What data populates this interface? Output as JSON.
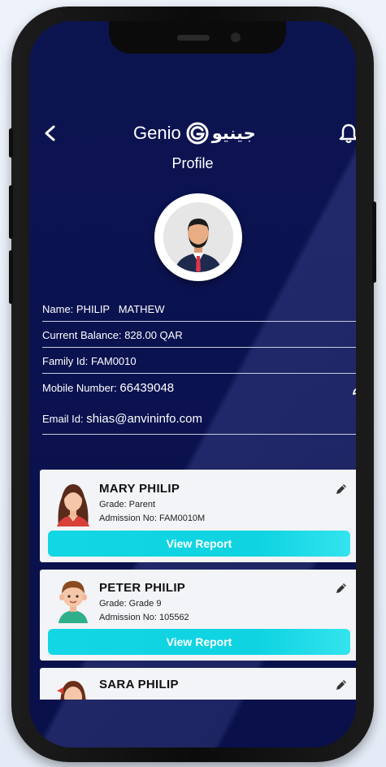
{
  "header": {
    "logo_text": "Genio",
    "logo_arabic": "جينيو",
    "title": "Profile"
  },
  "profile": {
    "name_label": "Name:",
    "name_value": "PHILIP   MATHEW",
    "balance_label": "Current Balance:",
    "balance_value": "828.00 QAR",
    "family_label": "Family Id:",
    "family_value": "FAM0010",
    "mobile_label": "Mobile Number:",
    "mobile_value": "66439048",
    "email_label": "Email Id:",
    "email_value": "shias@anvininfo.com"
  },
  "students": [
    {
      "name": "MARY  PHILIP",
      "grade": "Grade: Parent",
      "admission": "Admission No: FAM0010M",
      "button": "View Report",
      "avatar": "woman-avatar"
    },
    {
      "name": "PETER  PHILIP",
      "grade": "Grade: Grade 9",
      "admission": "Admission No: 105562",
      "button": "View Report",
      "avatar": "boy-avatar"
    },
    {
      "name": "SARA  PHILIP",
      "avatar": "girl-avatar"
    }
  ],
  "colors": {
    "screen_bg": "#0c1450",
    "accent_button": "#12d6e4",
    "card_bg": "#f3f4f7"
  },
  "icons": [
    "back-arrow-icon",
    "bell-icon",
    "genio-logo-icon",
    "pencil-edit-icon"
  ]
}
